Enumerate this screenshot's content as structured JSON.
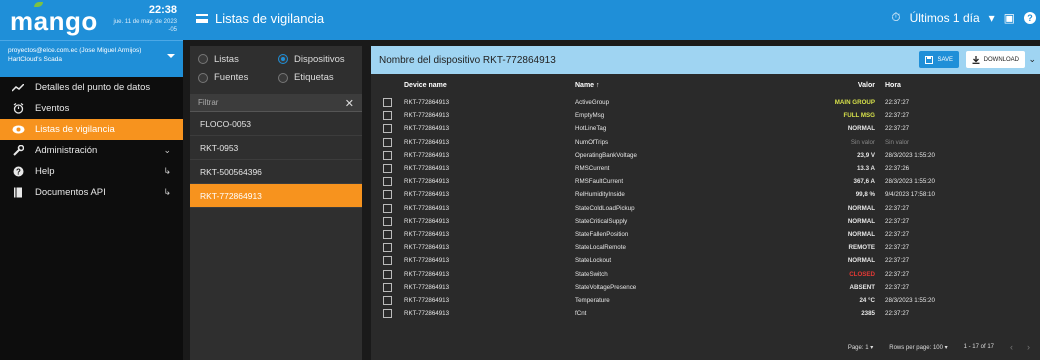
{
  "brand": {
    "logo": "mango",
    "time": "22:38",
    "date": "jue. 11 de may. de 2023",
    "tz": "-05"
  },
  "user": {
    "email": "proyectos@elce.com.ec (Jose Miguel Armijos)",
    "org": "HartCloud's Scada"
  },
  "sidebar": {
    "items": [
      {
        "label": "Detalles del punto de datos",
        "icon": "chart-line-icon",
        "trail": ""
      },
      {
        "label": "Eventos",
        "icon": "alarm-icon",
        "trail": ""
      },
      {
        "label": "Listas de vigilancia",
        "icon": "eye-icon",
        "trail": ""
      },
      {
        "label": "Administración",
        "icon": "wrench-icon",
        "trail": "⌄"
      },
      {
        "label": "Help",
        "icon": "help-icon",
        "trail": "↳"
      },
      {
        "label": "Documentos API",
        "icon": "book-icon",
        "trail": "↳"
      }
    ]
  },
  "topbar": {
    "title": "Listas de vigilancia",
    "range": "Últimos 1 día",
    "range_caret": "▾",
    "range_icon": "⏱",
    "cal_icon": "▣",
    "help_icon": "?"
  },
  "filters": {
    "listas": "Listas",
    "dispositivos": "Dispositivos",
    "fuentes": "Fuentes",
    "etiquetas": "Etiquetas",
    "filter_placeholder": "Filtrar",
    "clear": "✕"
  },
  "devices": [
    "FLOCO-0053",
    "RKT-0953",
    "RKT-500564396",
    "RKT-772864913"
  ],
  "main": {
    "header": "Nombre del dispositivo RKT-772864913",
    "save": "SAVE",
    "download": "DOWNLOAD",
    "chev": "⌄",
    "columns": {
      "device": "Device name",
      "name": "Name",
      "sort": "↑",
      "value": "Valor",
      "time": "Hora"
    },
    "rows": [
      {
        "device": "RKT-772864913",
        "name": "ActiveGroup",
        "value": "MAIN GROUP",
        "time": "22:37:27"
      },
      {
        "device": "RKT-772864913",
        "name": "EmptyMsg",
        "value": "FULL MSG",
        "time": "22:37:27"
      },
      {
        "device": "RKT-772864913",
        "name": "HotLineTag",
        "value": "NORMAL",
        "time": "22:37:27"
      },
      {
        "device": "RKT-772864913",
        "name": "NumOfTrips",
        "value": "Sin valor",
        "time": "Sin valor"
      },
      {
        "device": "RKT-772864913",
        "name": "OperatingBankVoltage",
        "value": "23,9 V",
        "time": "28/3/2023 1:55:20"
      },
      {
        "device": "RKT-772864913",
        "name": "RMSCurrent",
        "value": "13.3 A",
        "time": "22:37:26"
      },
      {
        "device": "RKT-772864913",
        "name": "RMSFaultCurrent",
        "value": "367,6 A",
        "time": "28/3/2023 1:55:20"
      },
      {
        "device": "RKT-772864913",
        "name": "RelHumidityInside",
        "value": "99,8 %",
        "time": "9/4/2023 17:58:10"
      },
      {
        "device": "RKT-772864913",
        "name": "StateColdLoadPickup",
        "value": "NORMAL",
        "time": "22:37:27"
      },
      {
        "device": "RKT-772864913",
        "name": "StateCriticalSupply",
        "value": "NORMAL",
        "time": "22:37:27"
      },
      {
        "device": "RKT-772864913",
        "name": "StateFallenPosition",
        "value": "NORMAL",
        "time": "22:37:27"
      },
      {
        "device": "RKT-772864913",
        "name": "StateLocalRemote",
        "value": "REMOTE",
        "time": "22:37:27"
      },
      {
        "device": "RKT-772864913",
        "name": "StateLockout",
        "value": "NORMAL",
        "time": "22:37:27"
      },
      {
        "device": "RKT-772864913",
        "name": "StateSwitch",
        "value": "CLOSED",
        "time": "22:37:27"
      },
      {
        "device": "RKT-772864913",
        "name": "StateVoltagePresence",
        "value": "ABSENT",
        "time": "22:37:27"
      },
      {
        "device": "RKT-772864913",
        "name": "Temperature",
        "value": "24 °C",
        "time": "28/3/2023 1:55:20"
      },
      {
        "device": "RKT-772864913",
        "name": "fCnt",
        "value": "2385",
        "time": "22:37:27"
      }
    ],
    "footer": {
      "page": "Page:",
      "page_value": "1",
      "rows_per_page": "Rows per page:",
      "rows_value": "100",
      "range": "1 - 17 of 17",
      "prev": "‹",
      "next": "›",
      "caret": "▾"
    }
  },
  "colors": {
    "accent": "#1f8fd8",
    "active": "#f7931e",
    "header_bar": "#9fd4f2",
    "yellow_value": "#d6e04a",
    "red_value": "#e53935"
  }
}
